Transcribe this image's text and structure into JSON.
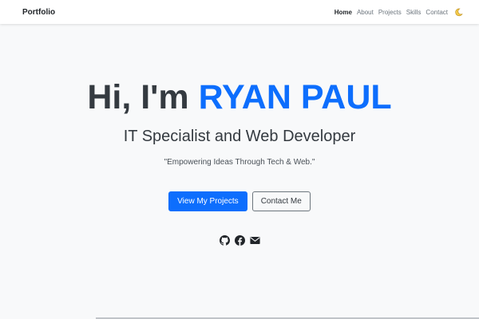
{
  "navbar": {
    "brand": "Portfolio",
    "links": [
      {
        "label": "Home",
        "active": true
      },
      {
        "label": "About"
      },
      {
        "label": "Projects"
      },
      {
        "label": "Skills"
      },
      {
        "label": "Contact"
      }
    ],
    "theme_toggle_icon": "moon-icon"
  },
  "hero": {
    "greeting": "Hi, I'm",
    "name": "RYAN PAUL",
    "subtitle": "IT Specialist and Web Developer",
    "tagline": "\"Empowering Ideas Through Tech & Web.\"",
    "buttons": {
      "primary": "View My Projects",
      "secondary": "Contact Me"
    },
    "social_icons": [
      "github-icon",
      "facebook-icon",
      "email-icon"
    ]
  },
  "colors": {
    "accent": "#0d6efd",
    "heading": "#343a40",
    "background": "#f8f9fa",
    "moon": "#f2c94c"
  }
}
